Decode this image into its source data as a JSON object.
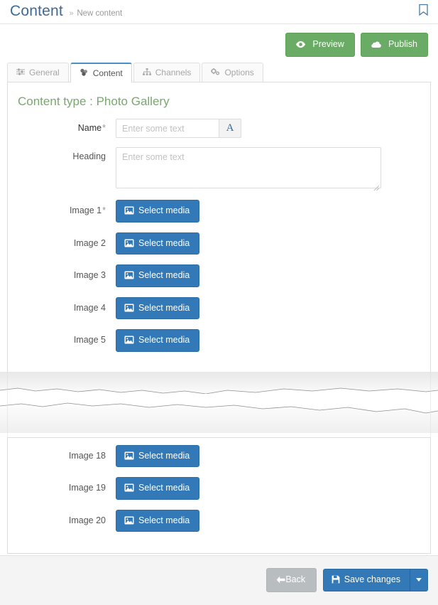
{
  "header": {
    "title": "Content",
    "breadcrumb_separator": "»",
    "breadcrumb_current": "New content",
    "bookmark_icon": "bookmark-icon"
  },
  "actions": {
    "preview_label": "Preview",
    "preview_icon": "eye-icon",
    "publish_label": "Publish",
    "publish_icon": "cloud-icon",
    "green": "#6aab65"
  },
  "tabs": [
    {
      "label": "General",
      "icon": "sliders-icon",
      "active": false
    },
    {
      "label": "Content",
      "icon": "cubes-icon",
      "active": true
    },
    {
      "label": "Channels",
      "icon": "sitemap-icon",
      "active": false
    },
    {
      "label": "Options",
      "icon": "cogs-icon",
      "active": false
    }
  ],
  "form": {
    "content_type_heading": "Content type : Photo Gallery",
    "name": {
      "label": "Name",
      "required_marker": "*",
      "value": "",
      "placeholder": "Enter some text",
      "addon_label": "A",
      "addon_icon": "font-icon"
    },
    "heading": {
      "label": "Heading",
      "value": "",
      "placeholder": "Enter some text"
    },
    "select_media_label": "Select media",
    "select_media_icon": "image-icon",
    "image_rows_top": [
      {
        "label": "Image 1",
        "required_marker": "*"
      },
      {
        "label": "Image 2",
        "required_marker": ""
      },
      {
        "label": "Image 3",
        "required_marker": ""
      },
      {
        "label": "Image 4",
        "required_marker": ""
      },
      {
        "label": "Image 5",
        "required_marker": ""
      }
    ],
    "image_rows_bottom": [
      {
        "label": "Image 18",
        "required_marker": ""
      },
      {
        "label": "Image 19",
        "required_marker": ""
      },
      {
        "label": "Image 20",
        "required_marker": ""
      }
    ]
  },
  "footer": {
    "back_label": "Back",
    "back_icon": "arrow-left-icon",
    "save_label": "Save changes",
    "save_icon": "floppy-disk-icon",
    "dropdown_icon": "caret-down-icon",
    "blue": "#3379b7"
  }
}
